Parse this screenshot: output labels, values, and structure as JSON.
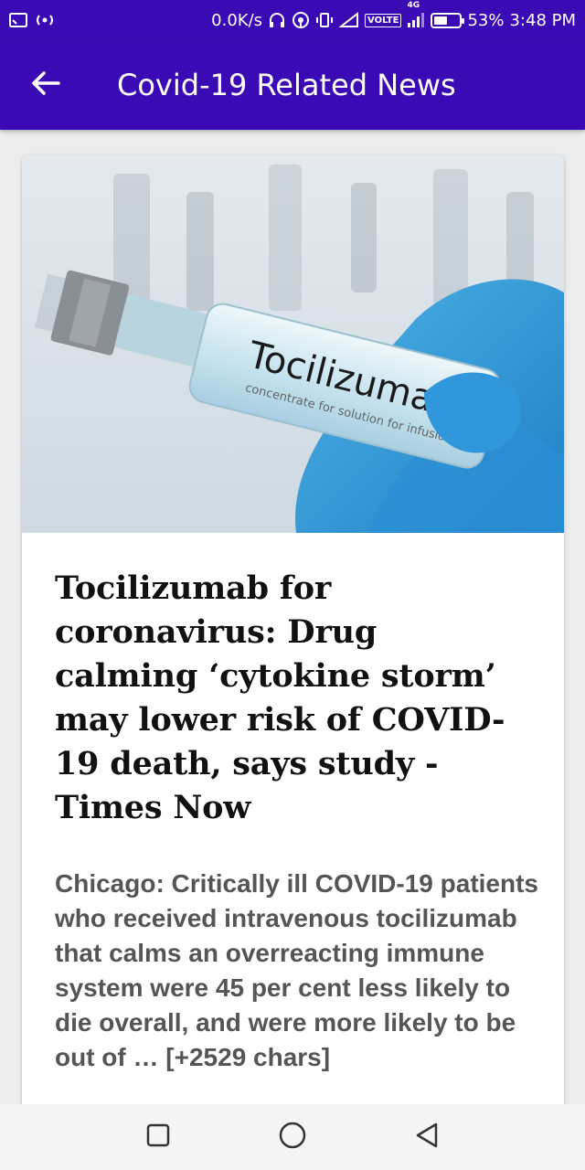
{
  "status_bar": {
    "network_speed": "0.0K/s",
    "network_type": "4G",
    "volte_label": "VOLTE",
    "battery_percent": "53%",
    "battery_level": 0.53,
    "time": "3:48 PM",
    "icons": [
      "cast-icon",
      "hotspot-icon",
      "headphones-icon",
      "wifi-hotspot-icon",
      "vibrate-icon",
      "signal-icon",
      "battery-icon"
    ]
  },
  "app_bar": {
    "title": "Covid-19 Related News",
    "back_icon": "arrow-left-icon"
  },
  "article": {
    "image_label": "Tocilizumab",
    "image_sublabel": "concentrate for solution for infusion",
    "headline": "Tocilizumab for coronavirus: Drug calming ‘cytokine storm’ may lower risk of COVID-19 death, says study - Times Now",
    "description": "Chicago: Critically ill COVID-19 patients who received intravenous tocilizumab that calms an overreacting immune system were 45 per cent less likely to die overall, and were more likely to be out of … [+2529 chars]"
  },
  "nav_bar": {
    "recents_icon": "square-icon",
    "home_icon": "circle-icon",
    "back_icon": "triangle-back-icon"
  },
  "colors": {
    "primary": "#3a0ab4",
    "headline": "#111111",
    "description": "#555555",
    "background": "#ececec"
  }
}
